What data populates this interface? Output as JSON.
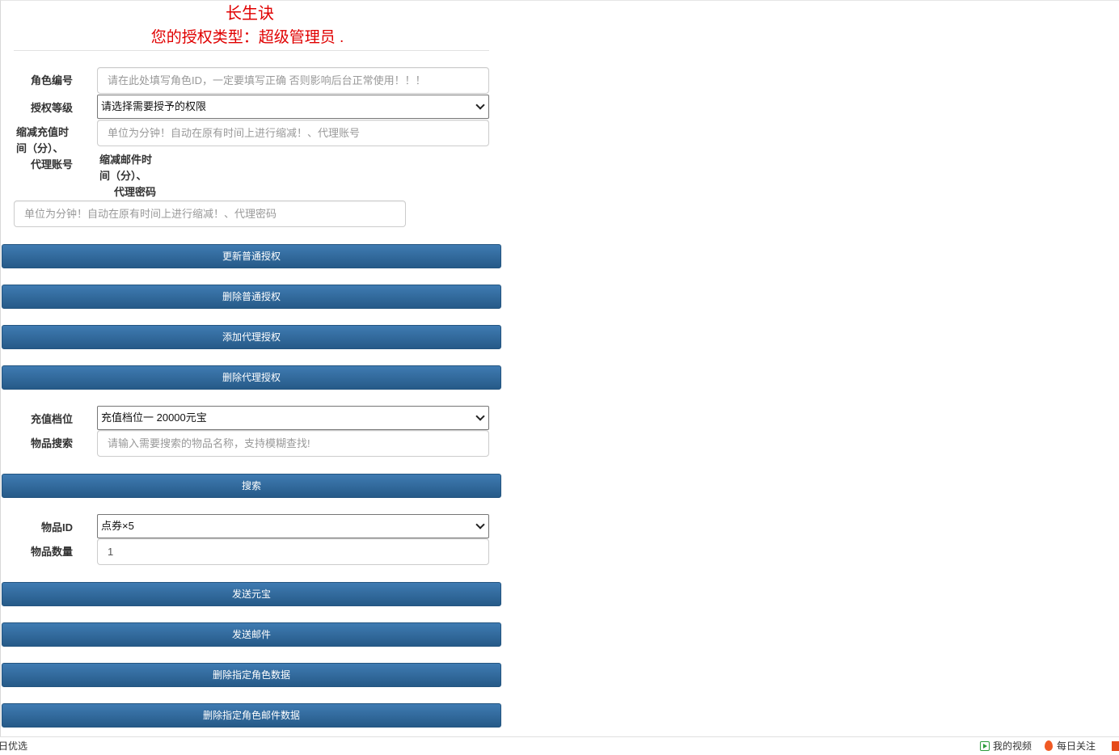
{
  "header": {
    "title": "长生诀",
    "subtitle": "您的授权类型：超级管理员 ."
  },
  "auth_form": {
    "role_id_label": "角色编号",
    "role_id_placeholder": "请在此处填写角色ID，一定要填写正确 否则影响后台正常使用！！！",
    "auth_level_label": "授权等级",
    "auth_level_value": "请选择需要授予的权限",
    "recharge_time_label_lines": [
      "缩减充值时",
      "间（分）、",
      "代理账号"
    ],
    "recharge_time_placeholder": "单位为分钟！自动在原有时间上进行缩减！、代理账号",
    "mail_time_label_lines": [
      "缩减邮件时",
      "间（分）、",
      "代理密码"
    ],
    "mail_time_placeholder": "单位为分钟！自动在原有时间上进行缩减！、代理密码"
  },
  "auth_buttons": {
    "update_normal": "更新普通授权",
    "delete_normal": "删除普通授权",
    "add_agent": "添加代理授权",
    "delete_agent": "删除代理授权"
  },
  "recharge_form": {
    "tier_label": "充值档位",
    "tier_value": "充值档位一 20000元宝",
    "search_label": "物品搜索",
    "search_placeholder": "请输入需要搜索的物品名称，支持模糊查找!",
    "search_button": "搜索"
  },
  "item_form": {
    "item_id_label": "物品ID",
    "item_id_value": "点券×5",
    "quantity_label": "物品数量",
    "quantity_value": "1"
  },
  "action_buttons": {
    "send_yuanbao": "发送元宝",
    "send_mail": "发送邮件",
    "delete_role_data": "删除指定角色数据",
    "delete_role_mail_data": "删除指定角色邮件数据"
  },
  "statusbar": {
    "left_text": "日优选",
    "my_video": "我的视频",
    "daily_follow": "每日关注"
  },
  "colors": {
    "title_red": "#e00000",
    "button_blue_top": "#3f7bb2",
    "button_blue_bottom": "#265a88"
  }
}
